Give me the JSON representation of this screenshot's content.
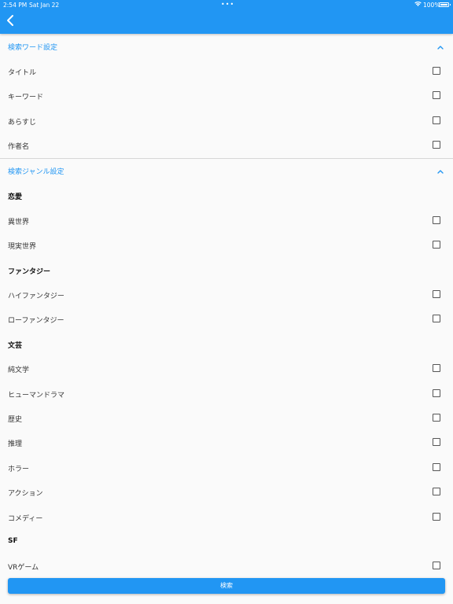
{
  "status_bar": {
    "time": "2:54 PM",
    "date": "Sat Jan 22",
    "dots": "•••",
    "battery": "100%"
  },
  "colors": {
    "accent": "#2196f3",
    "background": "#fafafa",
    "text": "#333333"
  },
  "sections": {
    "word": {
      "title": "検索ワード設定",
      "items": [
        "タイトル",
        "キーワード",
        "あらすじ",
        "作者名"
      ]
    },
    "genre": {
      "title": "検索ジャンル設定",
      "groups": [
        {
          "label": "恋愛",
          "items": [
            "異世界",
            "現実世界"
          ]
        },
        {
          "label": "ファンタジー",
          "items": [
            "ハイファンタジー",
            "ローファンタジー"
          ]
        },
        {
          "label": "文芸",
          "items": [
            "純文学",
            "ヒューマンドラマ",
            "歴史",
            "推理",
            "ホラー",
            "アクション",
            "コメディー"
          ]
        },
        {
          "label": "SF",
          "items": [
            "VRゲーム"
          ]
        }
      ]
    }
  },
  "search_button": {
    "label": "検索"
  }
}
